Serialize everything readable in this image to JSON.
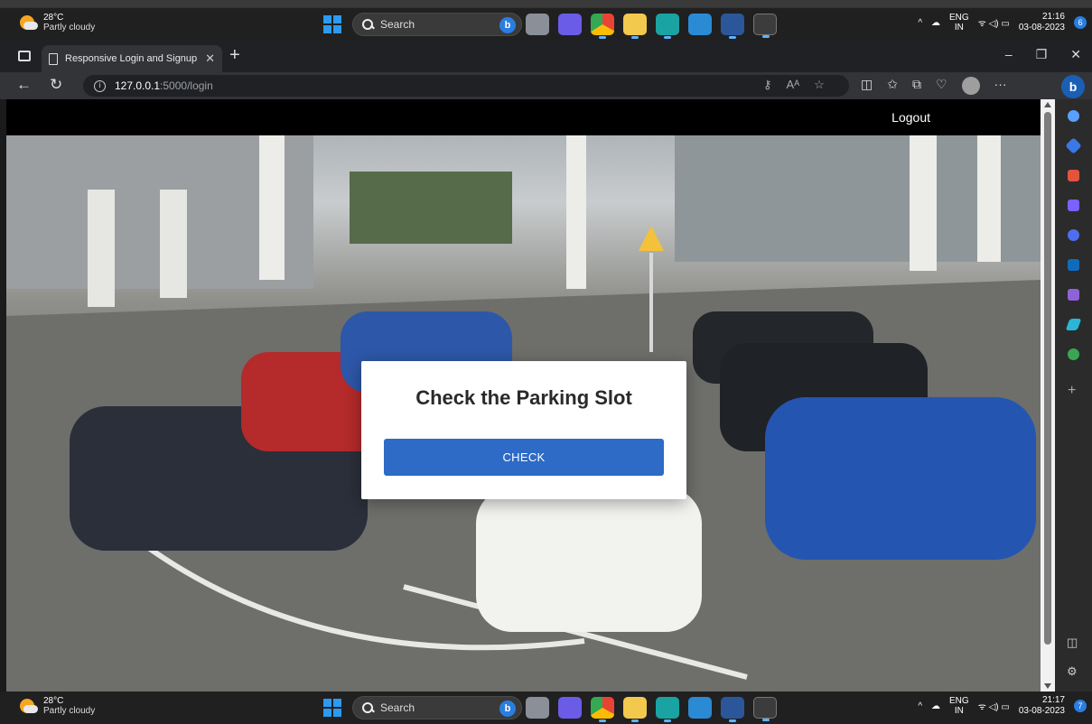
{
  "taskbar_top": {
    "temp": "28°C",
    "condition": "Partly cloudy",
    "search_label": "Search",
    "lang_1": "ENG",
    "lang_2": "IN",
    "time": "21:16",
    "date": "03-08-2023",
    "notif_count": "6"
  },
  "taskbar_bottom": {
    "temp": "28°C",
    "condition": "Partly cloudy",
    "search_label": "Search",
    "lang_1": "ENG",
    "lang_2": "IN",
    "time": "21:17",
    "date": "03-08-2023",
    "notif_count": "7"
  },
  "browser": {
    "tab_title": "Responsive Login and Signup Fo",
    "url_host": "127.0.0.1",
    "url_path": ":5000/login"
  },
  "page": {
    "logout_label": "Logout",
    "card_title": "Check the Parking Slot",
    "check_button": "CHECK"
  },
  "colors": {
    "navbar": "#000000",
    "button": "#2d6bc7",
    "taskbar": "#202020",
    "accent": "#2a7de1"
  },
  "icons": {
    "sidebar": [
      "search-icon",
      "tag-icon",
      "toolbox-icon",
      "people-icon",
      "copilot-icon",
      "outlook-icon",
      "edit-icon",
      "send-icon",
      "tree-icon",
      "add-icon"
    ]
  }
}
